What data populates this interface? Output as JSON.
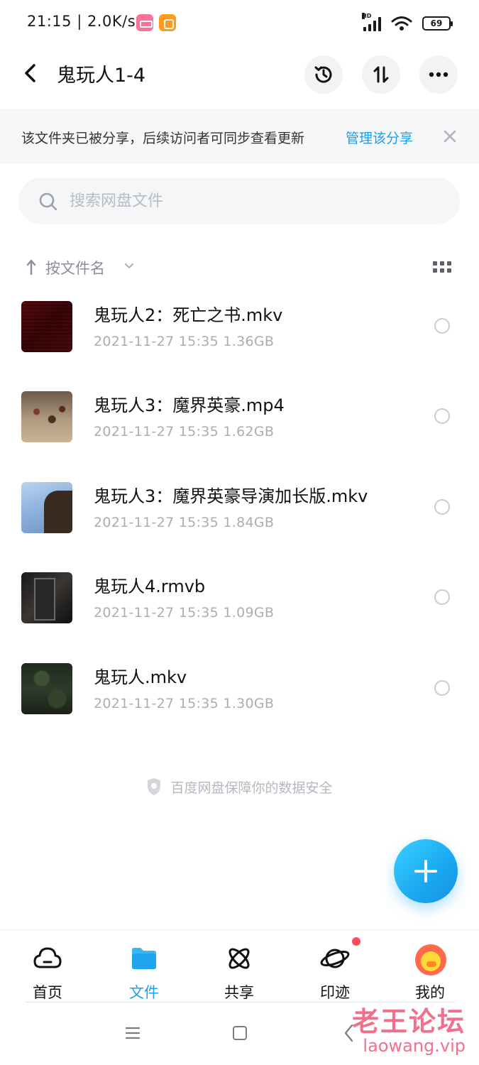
{
  "status_bar": {
    "text": "21:15 | 2.0K/s",
    "battery": "69",
    "network_label": "HD"
  },
  "header": {
    "title": "鬼玩人1-4"
  },
  "notice": {
    "text": "该文件夹已被分享，后续访问者可同步查看更新",
    "link": "管理该分享"
  },
  "search": {
    "placeholder": "搜索网盘文件"
  },
  "sort": {
    "label": "按文件名"
  },
  "files": [
    {
      "name": "鬼玩人2：死亡之书.mkv",
      "meta": "2021-11-27  15:35  1.36GB"
    },
    {
      "name": "鬼玩人3：魔界英豪.mp4",
      "meta": "2021-11-27  15:35  1.62GB"
    },
    {
      "name": "鬼玩人3：魔界英豪导演加长版.mkv",
      "meta": "2021-11-27  15:35  1.84GB"
    },
    {
      "name": "鬼玩人4.rmvb",
      "meta": "2021-11-27  15:35  1.09GB"
    },
    {
      "name": "鬼玩人.mkv",
      "meta": "2021-11-27  15:35  1.30GB"
    }
  ],
  "security_note": "百度网盘保障你的数据安全",
  "bottom_nav": {
    "items": [
      {
        "label": "首页",
        "icon": "cloud-icon"
      },
      {
        "label": "文件",
        "icon": "folder-icon",
        "active": true
      },
      {
        "label": "共享",
        "icon": "atom-icon"
      },
      {
        "label": "印迹",
        "icon": "planet-icon",
        "badge": true
      },
      {
        "label": "我的",
        "icon": "avatar"
      }
    ]
  },
  "watermark": {
    "title": "老王论坛",
    "url": "laowang.vip"
  },
  "colors": {
    "accent": "#1f9ee8",
    "fab": "#1ba8f0",
    "badge_red": "#ff4d5e"
  }
}
